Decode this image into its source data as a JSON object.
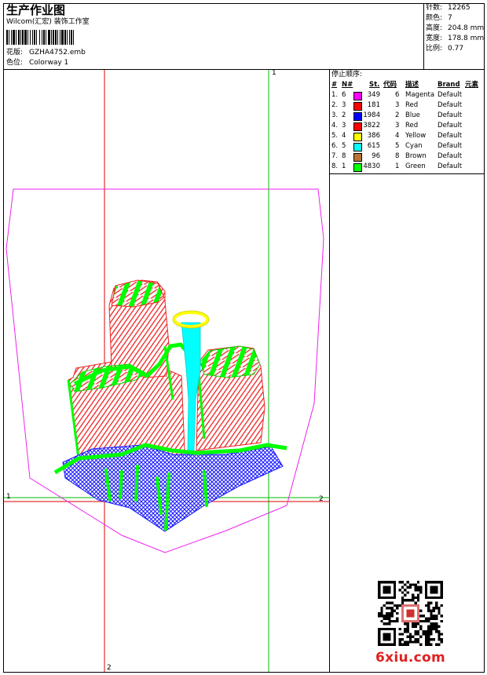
{
  "header": {
    "title": "生产作业图",
    "studio": "Wilcom(汇宏) 装饰工作室",
    "design_label": "花版:",
    "design_file": "GZHA4752.emb",
    "colorway_label": "色位:",
    "colorway": "Colorway 1"
  },
  "stats": [
    {
      "label": "针数:",
      "value": "12265"
    },
    {
      "label": "颜色:",
      "value": "7"
    },
    {
      "label": "高度:",
      "value": "204.8 mm"
    },
    {
      "label": "宽度:",
      "value": "178.8 mm"
    },
    {
      "label": "比例:",
      "value": "0.77"
    }
  ],
  "stop_sequence": {
    "title": "停止顺序:",
    "columns": [
      "#",
      "N#",
      "St.",
      "代码",
      "描述",
      "Brand",
      "元素"
    ],
    "rows": [
      {
        "n": "1.",
        "needle": "6",
        "stitches": "349",
        "code": "6",
        "desc": "Magenta",
        "brand": "Default",
        "color": "#ff00ff"
      },
      {
        "n": "2.",
        "needle": "3",
        "stitches": "181",
        "code": "3",
        "desc": "Red",
        "brand": "Default",
        "color": "#ff0000"
      },
      {
        "n": "3.",
        "needle": "2",
        "stitches": "1984",
        "code": "2",
        "desc": "Blue",
        "brand": "Default",
        "color": "#0000ff"
      },
      {
        "n": "4.",
        "needle": "3",
        "stitches": "3822",
        "code": "3",
        "desc": "Red",
        "brand": "Default",
        "color": "#ff0000"
      },
      {
        "n": "5.",
        "needle": "4",
        "stitches": "386",
        "code": "4",
        "desc": "Yellow",
        "brand": "Default",
        "color": "#ffff00"
      },
      {
        "n": "6.",
        "needle": "5",
        "stitches": "615",
        "code": "5",
        "desc": "Cyan",
        "brand": "Default",
        "color": "#00ffff"
      },
      {
        "n": "7.",
        "needle": "8",
        "stitches": "96",
        "code": "8",
        "desc": "Brown",
        "brand": "Default",
        "color": "#b87333"
      },
      {
        "n": "8.",
        "needle": "1",
        "stitches": "4830",
        "code": "1",
        "desc": "Green",
        "brand": "Default",
        "color": "#00ff00"
      }
    ]
  },
  "guides": {
    "h1": "1",
    "h2": "2",
    "v1": "1",
    "v2": "2"
  },
  "watermark": "6xiu.com",
  "colors": {
    "guide_red": "#dd0000",
    "guide_green": "#00bb00",
    "hoop": "#ee22ee",
    "stitch_red": "#ee2222",
    "stitch_blue": "#1a1aff",
    "stitch_green": "#00ff00"
  }
}
